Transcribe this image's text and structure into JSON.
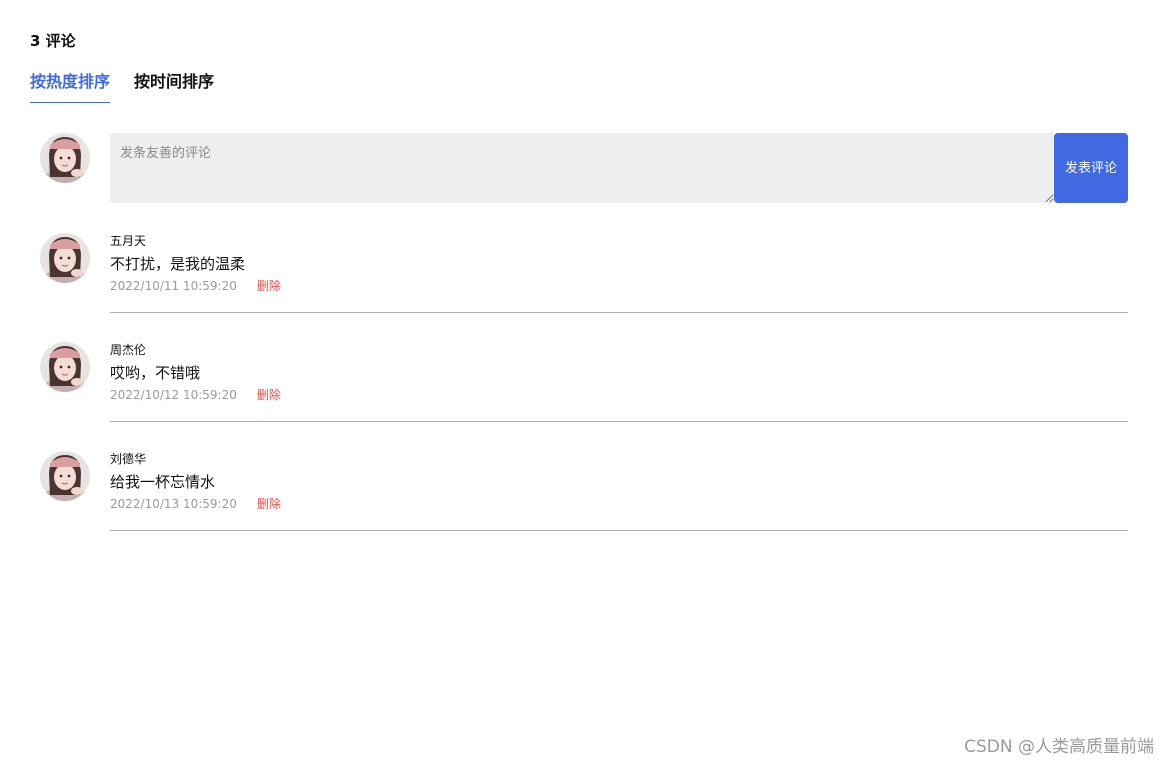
{
  "header": {
    "count_title": "3 评论",
    "tabs": [
      {
        "label": "按热度排序",
        "active": true
      },
      {
        "label": "按时间排序",
        "active": false
      }
    ]
  },
  "editor": {
    "placeholder": "发条友善的评论",
    "submit_label": "发表评论"
  },
  "comments": [
    {
      "user": "五月天",
      "text": "不打扰，是我的温柔",
      "time": "2022/10/11 10:59:20",
      "delete_label": "删除"
    },
    {
      "user": "周杰伦",
      "text": "哎哟，不错哦",
      "time": "2022/10/12 10:59:20",
      "delete_label": "删除"
    },
    {
      "user": "刘德华",
      "text": "给我一杯忘情水",
      "time": "2022/10/13 10:59:20",
      "delete_label": "删除"
    }
  ],
  "watermark": "CSDN @人类高质量前端",
  "colors": {
    "accent": "#4169e1",
    "delete": "#e0514f",
    "input_bg": "#eeeeee"
  }
}
